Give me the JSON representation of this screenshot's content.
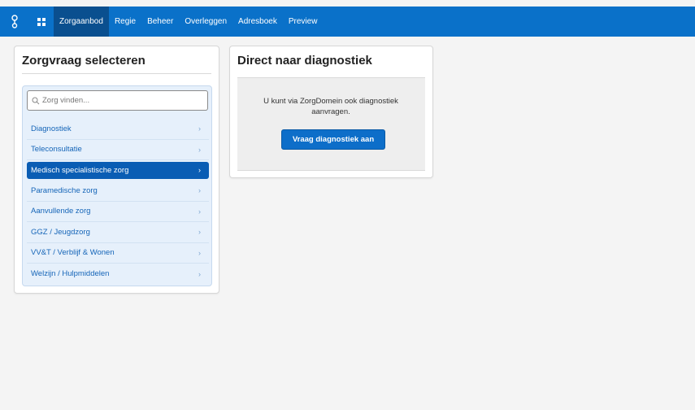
{
  "nav": {
    "items": [
      {
        "label": "Zorgaanbod",
        "active": true
      },
      {
        "label": "Regie"
      },
      {
        "label": "Beheer"
      },
      {
        "label": "Overleggen"
      },
      {
        "label": "Adresboek"
      },
      {
        "label": "Preview"
      }
    ]
  },
  "left_card": {
    "title": "Zorgvraag selecteren",
    "search_placeholder": "Zorg vinden...",
    "items": [
      {
        "label": "Diagnostiek"
      },
      {
        "label": "Teleconsultatie"
      },
      {
        "label": "Medisch specialistische zorg",
        "selected": true
      },
      {
        "label": "Paramedische zorg"
      },
      {
        "label": "Aanvullende zorg"
      },
      {
        "label": "GGZ / Jeugdzorg"
      },
      {
        "label": "VV&T / Verblijf & Wonen"
      },
      {
        "label": "Welzijn / Hulpmiddelen"
      }
    ]
  },
  "right_card": {
    "title": "Direct naar diagnostiek",
    "text": "U kunt via ZorgDomein ook diagnostiek aanvragen.",
    "button_label": "Vraag diagnostiek aan"
  },
  "colors": {
    "topbar": "#0a71c9",
    "nav_active": "#0a4f8f",
    "selected_item": "#0a5db4",
    "link": "#1565b8"
  },
  "icons": {
    "logo": "zorgdomein-logo-icon",
    "apps": "app-grid-icon",
    "search": "search-icon",
    "chevron": "chevron-right-icon"
  }
}
